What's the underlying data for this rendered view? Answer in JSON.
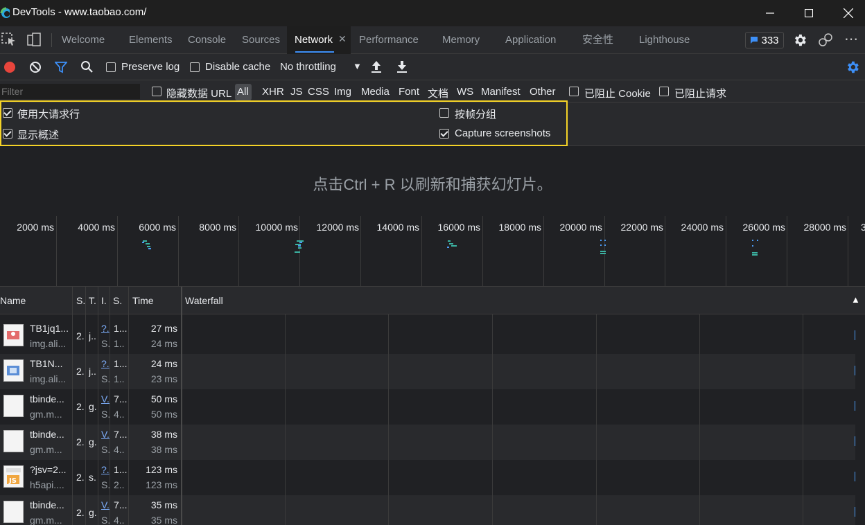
{
  "window": {
    "title": "DevTools - www.taobao.com/",
    "controls": [
      "minimize",
      "maximize",
      "close"
    ]
  },
  "tabs": [
    {
      "label": "Welcome"
    },
    {
      "label": "Elements"
    },
    {
      "label": "Console"
    },
    {
      "label": "Sources"
    },
    {
      "label": "Network",
      "active": true
    },
    {
      "label": "Performance"
    },
    {
      "label": "Memory"
    },
    {
      "label": "Application"
    },
    {
      "label": "安全性"
    },
    {
      "label": "Lighthouse"
    }
  ],
  "issues_count": "333",
  "toolbar": {
    "preserve_log": "Preserve log",
    "disable_cache": "Disable cache",
    "throttling": "No throttling"
  },
  "filter": {
    "placeholder": "Filter",
    "hide_data_urls": "隐藏数据 URL",
    "types": [
      "All",
      "XHR",
      "JS",
      "CSS",
      "Img",
      "Media",
      "Font",
      "文档",
      "WS",
      "Manifest",
      "Other"
    ],
    "blocked_cookies": "已阻止 Cookie",
    "blocked_requests": "已阻止请求"
  },
  "settings": {
    "large_rows": "使用大请求行",
    "show_overview": "显示概述",
    "group_by_frame": "按帧分组",
    "capture_screenshots": "Capture screenshots"
  },
  "overview_hint": "点击Ctrl + R 以刷新和捕获幻灯片。",
  "timeline_ticks": [
    "2000 ms",
    "4000 ms",
    "6000 ms",
    "8000 ms",
    "10000 ms",
    "12000 ms",
    "14000 ms",
    "16000 ms",
    "18000 ms",
    "20000 ms",
    "22000 ms",
    "24000 ms",
    "26000 ms",
    "28000 ms",
    "3"
  ],
  "table": {
    "headers": {
      "name": "Name",
      "status": "S.",
      "type": "T.",
      "initiator": "I.",
      "size": "S.",
      "time": "Time",
      "waterfall": "Waterfall"
    },
    "rows": [
      {
        "name": "TB1jq1...",
        "domain": "img.ali...",
        "status": "2.",
        "type": "j..",
        "initiator": "?.",
        "initiator_sub": "S.",
        "size": "1...",
        "size_sub": "1..",
        "time": "27 ms",
        "latency": "24 ms",
        "icon": "image-thumb-red"
      },
      {
        "name": "TB1N...",
        "domain": "img.ali...",
        "status": "2.",
        "type": "j..",
        "initiator": "?.",
        "initiator_sub": "S.",
        "size": "1...",
        "size_sub": "1..",
        "time": "24 ms",
        "latency": "23 ms",
        "icon": "image-thumb-blue"
      },
      {
        "name": "tbinde...",
        "domain": "gm.m...",
        "status": "2.",
        "type": "g.",
        "initiator": "V.",
        "initiator_sub": "S.",
        "size": "7...",
        "size_sub": "4..",
        "time": "50 ms",
        "latency": "50 ms",
        "icon": "blank-doc"
      },
      {
        "name": "tbinde...",
        "domain": "gm.m...",
        "status": "2.",
        "type": "g.",
        "initiator": "V.",
        "initiator_sub": "S.",
        "size": "7...",
        "size_sub": "4..",
        "time": "38 ms",
        "latency": "38 ms",
        "icon": "blank-doc"
      },
      {
        "name": "?jsv=2...",
        "domain": "h5api....",
        "status": "2.",
        "type": "s.",
        "initiator": "?.",
        "initiator_sub": "S.",
        "size": "1...",
        "size_sub": "2..",
        "time": "123 ms",
        "latency": "123 ms",
        "icon": "js-file"
      },
      {
        "name": "tbinde...",
        "domain": "gm.m...",
        "status": "2.",
        "type": "g.",
        "initiator": "V.",
        "initiator_sub": "S.",
        "size": "7...",
        "size_sub": "4..",
        "time": "35 ms",
        "latency": "35 ms",
        "icon": "blank-doc"
      }
    ]
  },
  "colors": {
    "accent": "#3d8ff7",
    "highlight_box": "#f5d327",
    "record": "#e8453c"
  }
}
